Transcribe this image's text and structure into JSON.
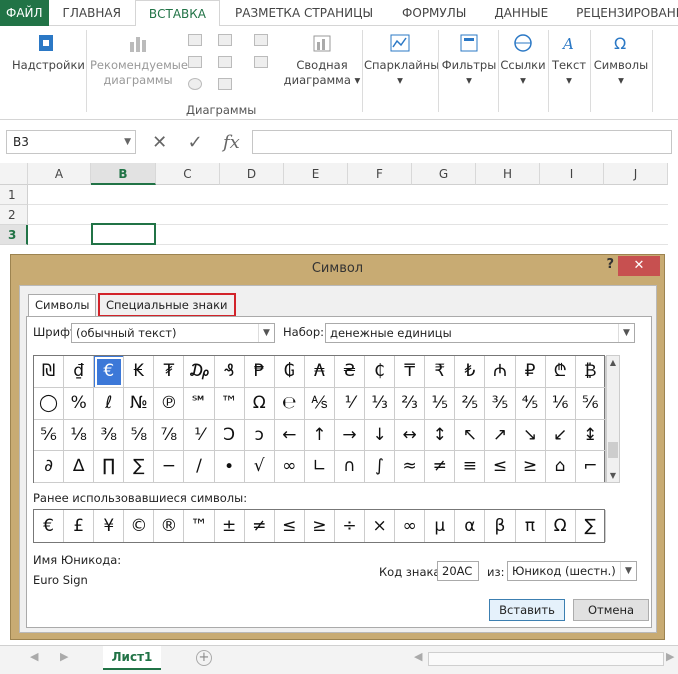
{
  "ribbon_tabs": [
    "ФАЙЛ",
    "ГЛАВНАЯ",
    "ВСТАВКА",
    "РАЗМЕТКА СТРАНИЦЫ",
    "ФОРМУЛЫ",
    "ДАННЫЕ",
    "РЕЦЕНЗИРОВАНИ"
  ],
  "ribbon": {
    "addins": "Надстройки",
    "rec_charts_1": "Рекомендуемые",
    "rec_charts_2": "диаграммы",
    "pivot_chart_1": "Сводная",
    "pivot_chart_2": "диаграмма",
    "charts_group": "Диаграммы",
    "sparklines": "Спарклайны",
    "filters": "Фильтры",
    "links": "Ссылки",
    "text": "Текст",
    "symbols": "Символы"
  },
  "formula_bar": {
    "name_box": "B3",
    "fx": "fx",
    "value": ""
  },
  "columns": [
    "A",
    "B",
    "C",
    "D",
    "E",
    "F",
    "G",
    "H",
    "I",
    "J"
  ],
  "rows": [
    "1",
    "2",
    "3"
  ],
  "selected_cell": "B3",
  "dialog": {
    "title": "Символ",
    "help": "?",
    "close": "✕",
    "tab_symbols": "Символы",
    "tab_special": "Специальные знаки",
    "font_label": "Шрифт:",
    "font_value": "(обычный текст)",
    "subset_label": "Набор:",
    "subset_value": "денежные единицы",
    "symbols": [
      [
        "₪",
        "₫",
        "€",
        "₭",
        "₮",
        "₯",
        "₰",
        "₱",
        "₲",
        "₳",
        "₴",
        "₵",
        "₸",
        "₹",
        "₺",
        "₼",
        "₽",
        "₾",
        "₿"
      ],
      [
        "◯",
        "%",
        "ℓ",
        "№",
        "℗",
        "℠",
        "™",
        "Ω",
        "℮",
        "⅍",
        "⅟",
        "⅓",
        "⅔",
        "⅕",
        "⅖",
        "⅗",
        "⅘",
        "⅙",
        "⅚"
      ],
      [
        "⅚",
        "⅛",
        "⅜",
        "⅝",
        "⅞",
        "⅟",
        "Ↄ",
        "ↄ",
        "←",
        "↑",
        "→",
        "↓",
        "↔",
        "↕",
        "↖",
        "↗",
        "↘",
        "↙",
        "↨"
      ],
      [
        "∂",
        "∆",
        "∏",
        "∑",
        "−",
        "∕",
        "∙",
        "√",
        "∞",
        "∟",
        "∩",
        "∫",
        "≈",
        "≠",
        "≡",
        "≤",
        "≥",
        "⌂",
        "⌐"
      ]
    ],
    "selected_symbol": "€",
    "recent_label": "Ранее использовавшиеся символы:",
    "recent": [
      "€",
      "£",
      "¥",
      "©",
      "®",
      "™",
      "±",
      "≠",
      "≤",
      "≥",
      "÷",
      "×",
      "∞",
      "µ",
      "α",
      "β",
      "π",
      "Ω",
      "∑"
    ],
    "unicode_name_label": "Имя Юникода:",
    "unicode_name": "Euro Sign",
    "code_label": "Код знака:",
    "code_value": "20AC",
    "from_label": "из:",
    "from_value": "Юникод (шестн.)",
    "insert_button": "Вставить",
    "cancel_button": "Отмена"
  },
  "sheet_tab": "Лист1"
}
